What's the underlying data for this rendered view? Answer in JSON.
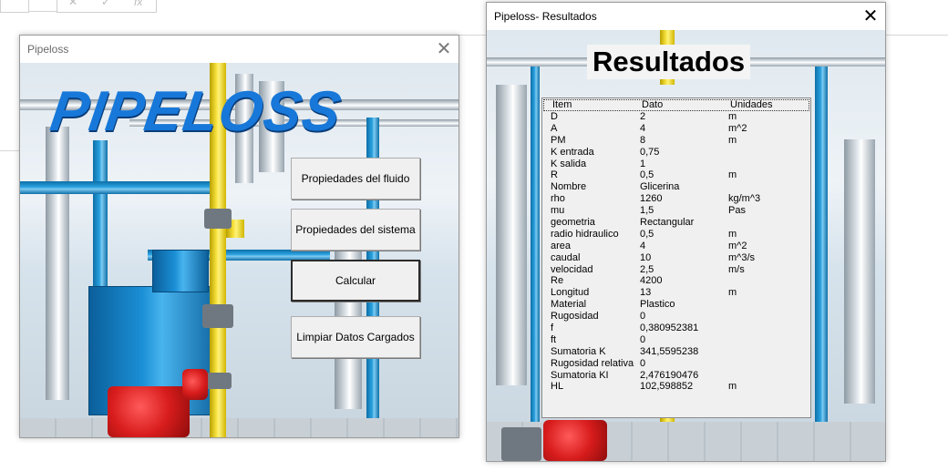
{
  "background": {
    "fx_label": "fx"
  },
  "pipeloss_window": {
    "title": "Pipeloss",
    "logo": "PIPELOSS",
    "buttons": {
      "fluid_props": "Propiedades del fluido",
      "system_props": "Propiedades del sistema",
      "calculate": "Calcular",
      "clear_data": "Limpiar Datos Cargados"
    }
  },
  "results_window": {
    "title": "Pipeloss- Resultados",
    "heading": "Resultados",
    "table": {
      "columns": [
        "Item",
        "Dato",
        "Unidades"
      ],
      "rows": [
        [
          "D",
          "2",
          "m"
        ],
        [
          "A",
          "4",
          "m^2"
        ],
        [
          "PM",
          "8",
          "m"
        ],
        [
          "K entrada",
          "0,75",
          ""
        ],
        [
          "K salida",
          "1",
          ""
        ],
        [
          "R",
          "0,5",
          "m"
        ],
        [
          "Nombre",
          "Glicerina",
          ""
        ],
        [
          "rho",
          "1260",
          "kg/m^3"
        ],
        [
          "mu",
          "1,5",
          "Pas"
        ],
        [
          "geometria",
          "Rectangular",
          ""
        ],
        [
          "radio hidraulico",
          "0,5",
          "m"
        ],
        [
          "area",
          "4",
          "m^2"
        ],
        [
          "caudal",
          "10",
          "m^3/s"
        ],
        [
          "velocidad",
          "2,5",
          "m/s"
        ],
        [
          "Re",
          "4200",
          ""
        ],
        [
          "Longitud",
          "13",
          "m"
        ],
        [
          "Material",
          "Plastico",
          ""
        ],
        [
          "Rugosidad",
          "0",
          ""
        ],
        [
          "f",
          "0,380952381",
          ""
        ],
        [
          "ft",
          "0",
          ""
        ],
        [
          "Sumatoria K",
          "341,5595238",
          ""
        ],
        [
          "Rugosidad relativa",
          "0",
          ""
        ],
        [
          "Sumatoria KI",
          "2,476190476",
          ""
        ],
        [
          "HL",
          "102,598852",
          "m"
        ]
      ]
    }
  },
  "colors": {
    "logo_blue": "#1778d9",
    "pipe_yellow": "#f7e13b",
    "pipe_blue": "#2aa1df",
    "burner_red": "#d81c1c"
  },
  "icons": [
    "close-icon",
    "fx-icon",
    "cancel-icon",
    "check-icon"
  ]
}
